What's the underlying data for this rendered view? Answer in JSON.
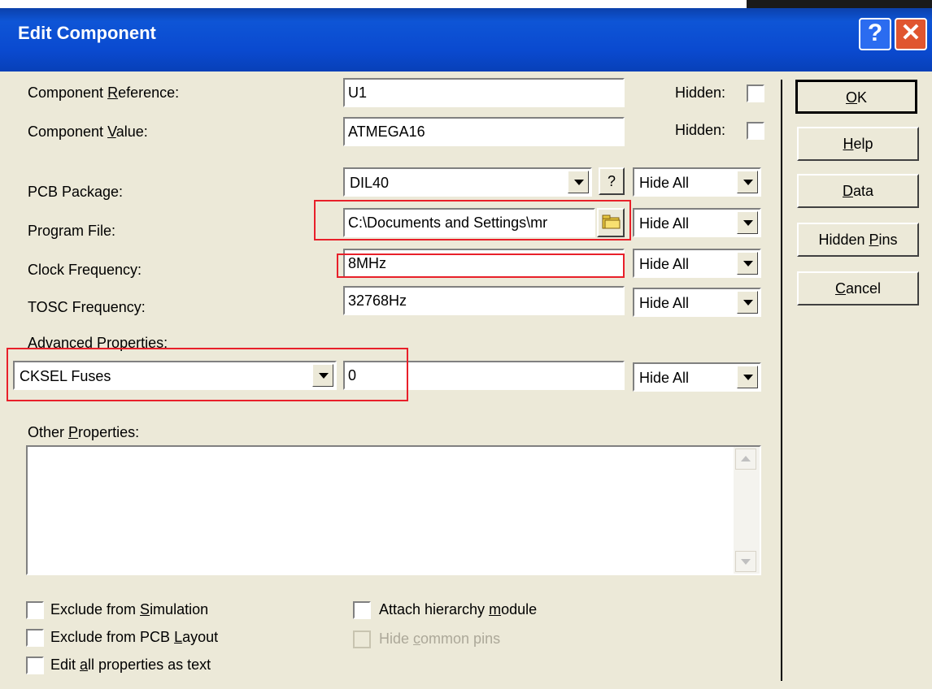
{
  "window": {
    "title": "Edit Component",
    "help_glyph": "?",
    "close_glyph": "✕"
  },
  "fields": {
    "ref_label_pre": "Component ",
    "ref_label_u": "R",
    "ref_label_post": "eference:",
    "ref_value": "U1",
    "val_label_pre": "Component ",
    "val_label_u": "V",
    "val_label_post": "alue:",
    "val_value": "ATMEGA16",
    "hidden_label": "Hidden:",
    "pcb_label": "PCB Package:",
    "pcb_value": "DIL40",
    "pcb_help": "?",
    "program_label": "Program File:",
    "program_value": "C:\\Documents and Settings\\mr",
    "clock_label": "Clock Frequency:",
    "clock_value": "8MHz",
    "tosc_label": "TOSC Frequency:",
    "tosc_value": "32768Hz",
    "hide_all": "Hide All",
    "adv_label": "Advanced Properties:",
    "adv_select": "CKSEL Fuses",
    "adv_value": "0",
    "other_label_pre": "Other ",
    "other_label_u": "P",
    "other_label_post": "roperties:",
    "other_value": ""
  },
  "checks": {
    "excl_sim_pre": "Exclude from ",
    "excl_sim_u": "S",
    "excl_sim_post": "imulation",
    "excl_pcb_pre": "Exclude from PCB ",
    "excl_pcb_u": "L",
    "excl_pcb_post": "ayout",
    "edit_all_pre": "Edit ",
    "edit_all_u": "a",
    "edit_all_post": "ll properties as text",
    "attach_pre": "Attach hierarchy ",
    "attach_u": "m",
    "attach_post": "odule",
    "hide_common_pre": "Hide ",
    "hide_common_u": "c",
    "hide_common_post": "ommon pins"
  },
  "buttons": {
    "ok_u": "O",
    "ok_post": "K",
    "help_u": "H",
    "help_post": "elp",
    "data_u": "D",
    "data_post": "ata",
    "hpins_pre": "Hidden ",
    "hpins_u": "P",
    "hpins_post": "ins",
    "cancel_u": "C",
    "cancel_post": "ancel"
  }
}
